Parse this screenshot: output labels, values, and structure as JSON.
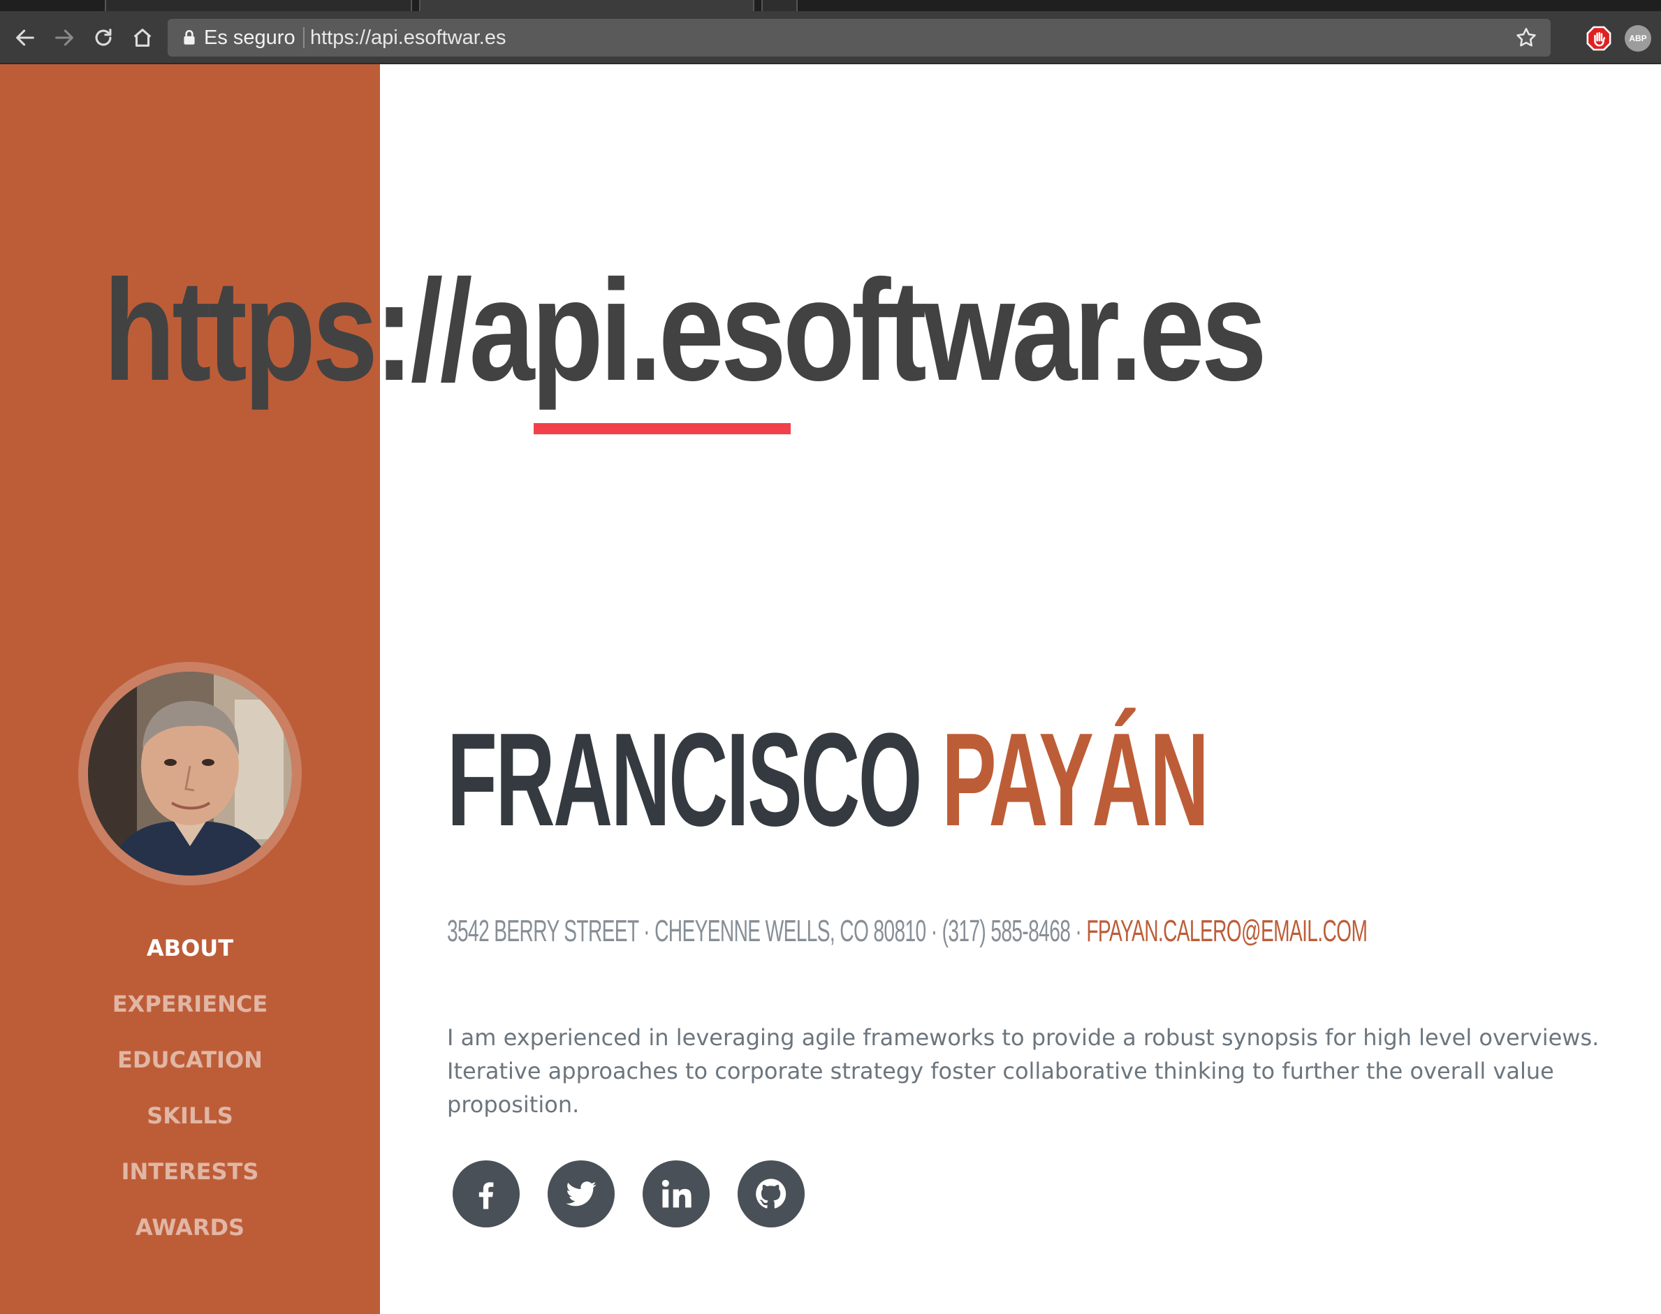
{
  "browser": {
    "security_label": "Es seguro",
    "url": "https://api.esoftwar.es",
    "icons": {
      "back": "back-arrow-icon",
      "forward": "forward-arrow-icon",
      "reload": "reload-icon",
      "home": "home-icon",
      "lock": "lock-icon",
      "bookmark": "star-icon",
      "extension_stop": "stop-hand-icon",
      "extension_abp": "adblock-plus-icon"
    },
    "abp_label": "ABP"
  },
  "overlay": {
    "big_url": "https://api.esoftwar.es",
    "underline_color": "#f2404a"
  },
  "sidebar": {
    "background": "#bd5d38",
    "nav": [
      {
        "label": "About",
        "active": true
      },
      {
        "label": "Experience",
        "active": false
      },
      {
        "label": "Education",
        "active": false
      },
      {
        "label": "Skills",
        "active": false
      },
      {
        "label": "Interests",
        "active": false
      },
      {
        "label": "Awards",
        "active": false
      }
    ]
  },
  "profile": {
    "first_name": "FRANCISCO",
    "last_name": "PAYÁN",
    "contact_plain": "3542 Berry Street · Cheyenne Wells, CO 80810 · (317) 585-8468 · ",
    "email": "fpayan.calero@email.com",
    "bio": "I am experienced in leveraging agile frameworks to provide a robust synopsis for high level overviews. Iterative approaches to corporate strategy foster collaborative thinking to further the overall value proposition.",
    "accent_color": "#bd5d38",
    "text_color": "#343a40"
  },
  "social": [
    {
      "name": "facebook",
      "icon": "facebook-icon"
    },
    {
      "name": "twitter",
      "icon": "twitter-icon"
    },
    {
      "name": "linkedin",
      "icon": "linkedin-icon"
    },
    {
      "name": "github",
      "icon": "github-icon"
    }
  ]
}
